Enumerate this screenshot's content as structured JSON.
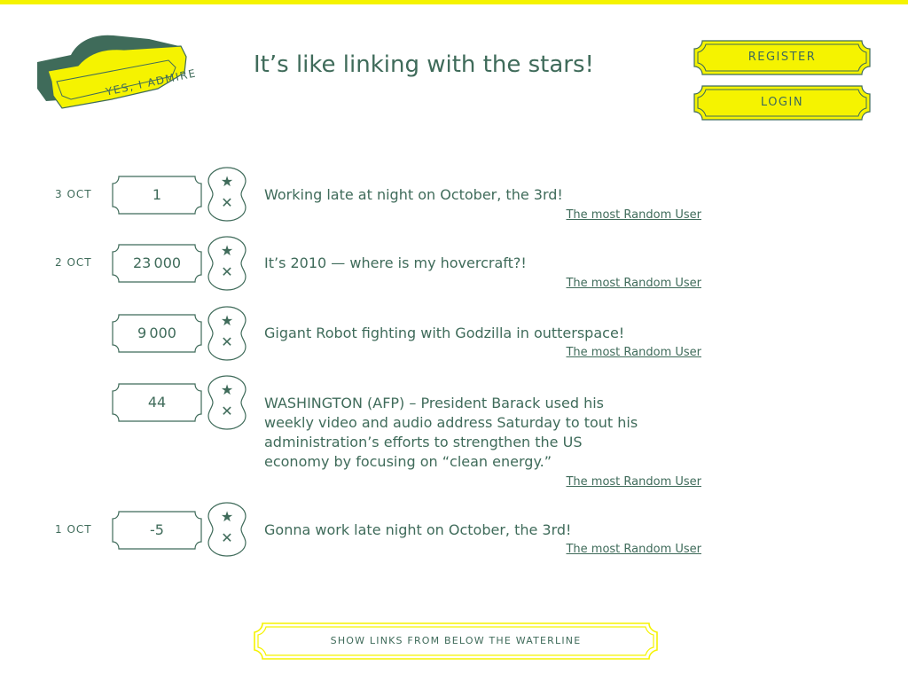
{
  "colors": {
    "accent": "#f5f300",
    "ink": "#3f6b5a",
    "background": "#ffffff"
  },
  "logo": {
    "text": "YES, I ADMIRE"
  },
  "header": {
    "tagline": "It’s like linking with the stars!"
  },
  "auth": {
    "register_label": "REGISTER",
    "login_label": "LOGIN"
  },
  "vote_icons": {
    "star": "★",
    "remove": "✕"
  },
  "posts": [
    {
      "date": "3 OCT",
      "score": "1",
      "text": "Working late at night on October, the 3rd!",
      "user": "The most Random User"
    },
    {
      "date": "2 OCT",
      "score": "23 000",
      "text": "It’s 2010 — where is my hovercraft?!",
      "user": "The most Random User"
    },
    {
      "date": "",
      "score": "9 000",
      "text": "Gigant Robot fighting with Godzilla in outterspace!",
      "user": "The most Random User"
    },
    {
      "date": "",
      "score": "44",
      "text": " WASHINGTON (AFP) – President Barack  used his weekly video and audio address Saturday to tout his administration’s efforts to strengthen the US economy  by focusing on “clean energy.”",
      "user": "The most Random User"
    },
    {
      "date": "1 OCT",
      "score": "-5",
      "text": "Gonna work late night on October, the 3rd!",
      "user": "The most Random User"
    }
  ],
  "footer": {
    "show_more_label": "SHOW LINKS  FROM BELOW THE WATERLINE"
  }
}
